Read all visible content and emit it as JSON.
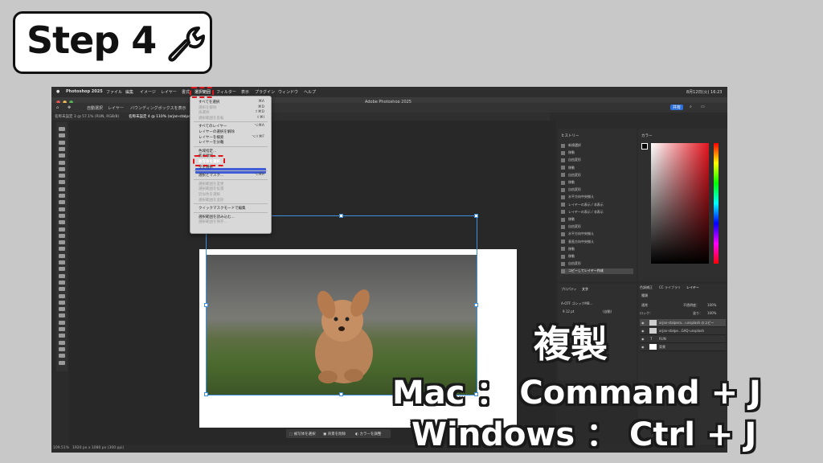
{
  "step_badge": {
    "label": "Step 4",
    "icon": "wrench-icon"
  },
  "app": {
    "window_title": "Adobe Photoshop 2025",
    "menubar": {
      "apple": "",
      "items": [
        "Photoshop 2025",
        "ファイル",
        "編集",
        "イメージ",
        "レイヤー",
        "書式",
        "選択範囲",
        "フィルター",
        "表示",
        "プラグイン",
        "ウィンドウ",
        "ヘルプ"
      ],
      "clock": "8月12日(火) 16:23"
    },
    "options_bar": {
      "auto_select": "自動選択",
      "layer": "レイヤー",
      "bounding_box": "バウンディングボックスを表示"
    },
    "tabs": [
      "名称未設定 3 @ 57.1% (RUN, RGB/8)",
      "名称未設定 4 @ 110% (arjan-stalpe"
    ],
    "status": {
      "zoom": "109.51%",
      "doc_size": "1920 px x 1080 px (300 ppi)"
    },
    "context_bar": {
      "select_subject": "被写体を選択",
      "remove_bg": "背景を削除",
      "color_adjust": "カラーを調整"
    },
    "select_menu": {
      "items": [
        {
          "label": "すべてを選択",
          "shortcut": "⌘A",
          "enabled": true
        },
        {
          "label": "選択を解除",
          "shortcut": "⌘D",
          "enabled": false
        },
        {
          "label": "再選択",
          "shortcut": "⇧⌘D",
          "enabled": false
        },
        {
          "label": "選択範囲を反転",
          "shortcut": "⇧⌘I",
          "enabled": false
        },
        {
          "label": "すべてのレイヤー",
          "shortcut": "⌥⌘A",
          "enabled": true
        },
        {
          "label": "レイヤーの選択を解除",
          "shortcut": "",
          "enabled": true
        },
        {
          "label": "レイヤーを検索",
          "shortcut": "⌥⇧⌘F",
          "enabled": true
        },
        {
          "label": "レイヤーを分離",
          "shortcut": "",
          "enabled": true
        },
        {
          "label": "色域指定...",
          "shortcut": "",
          "enabled": true
        },
        {
          "label": "焦点領域...",
          "shortcut": "",
          "enabled": true
        },
        {
          "label": "被写体を選択",
          "shortcut": "",
          "enabled": true
        },
        {
          "label": "空を選択",
          "shortcut": "",
          "enabled": true
        },
        {
          "label": "選択とマスク...",
          "shortcut": "⌥⌘R",
          "enabled": true
        },
        {
          "label": "選択範囲を変更",
          "shortcut": "",
          "enabled": false
        },
        {
          "label": "選択範囲を拡張",
          "shortcut": "",
          "enabled": false
        },
        {
          "label": "近似色を選択",
          "shortcut": "",
          "enabled": false
        },
        {
          "label": "選択範囲を変形",
          "shortcut": "",
          "enabled": false
        },
        {
          "label": "クイックマスクモードで編集",
          "shortcut": "",
          "enabled": true
        },
        {
          "label": "選択範囲を読み込む...",
          "shortcut": "",
          "enabled": true
        },
        {
          "label": "選択範囲を保存...",
          "shortcut": "",
          "enabled": false
        }
      ],
      "highlighted": "被写体を選択"
    },
    "history_panel": {
      "tab": "ヒストリー",
      "rows": [
        "新規選択",
        "移動",
        "自由変形",
        "移動",
        "自由変形",
        "移動",
        "自由変形",
        "水平方向中央揃え",
        "レイヤーの表示 / 非表示",
        "レイヤーの表示 / 非表示",
        "移動",
        "自由変形",
        "水平方向中央揃え",
        "垂直方向中央揃え",
        "移動",
        "移動",
        "自由変形",
        "コピーしてレイヤー作成"
      ]
    },
    "color_panel": {
      "tab": "カラー"
    },
    "properties_panel": {
      "tabs": [
        "プロパティ",
        "文字"
      ],
      "font": "A-OTF ゴシックMB...",
      "size": "9.12 pt",
      "auto": "(自動)"
    },
    "layers_panel": {
      "tabs": [
        "色調補正",
        "CC ライブラリ",
        "レイヤー"
      ],
      "search": "種類",
      "blend": "通常",
      "opacity_label": "不透明度：",
      "opacity": "100%",
      "lock_label": "ロック：",
      "fill_label": "塗り：",
      "fill": "100%",
      "layers": [
        "arjan-stalpera...-unsplash のコピー",
        "arjan-stalpe...GAQ-unsplash",
        "RUN",
        "背景"
      ]
    }
  },
  "caption": {
    "title": "複製",
    "mac": "Mac ： Command + J",
    "windows": "Windows ： Ctrl + J"
  },
  "colors": {
    "highlight_red": "#e0161d",
    "menu_highlight": "#3f5dd6",
    "selection_blue": "#3e8ede"
  }
}
